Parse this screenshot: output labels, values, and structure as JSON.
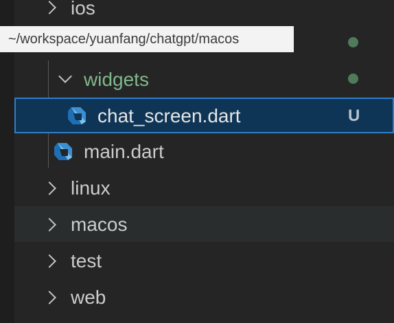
{
  "tooltip": {
    "path": "~/workspace/yuanfang/chatgpt/macos"
  },
  "tree": {
    "ios": {
      "label": "ios",
      "icon": "chevron-right-icon"
    },
    "widgets": {
      "label": "widgets",
      "icon": "chevron-down-icon",
      "status_color": "#81b88b"
    },
    "chat_screen": {
      "label": "chat_screen.dart",
      "badge": "U",
      "icon": "dart-file-icon",
      "selected": true
    },
    "main": {
      "label": "main.dart",
      "icon": "dart-file-icon"
    },
    "linux": {
      "label": "linux",
      "icon": "chevron-right-icon"
    },
    "macos": {
      "label": "macos",
      "icon": "chevron-right-icon",
      "hovered": true
    },
    "test": {
      "label": "test",
      "icon": "chevron-right-icon"
    },
    "web": {
      "label": "web",
      "icon": "chevron-right-icon"
    }
  },
  "colors": {
    "background": "#1e1e1e",
    "sidebar": "#252526",
    "selection_bg": "#0f3556",
    "selection_border": "#2f7fcb",
    "untracked_green": "#81b88b",
    "dart_blue": "#54a9e0"
  }
}
